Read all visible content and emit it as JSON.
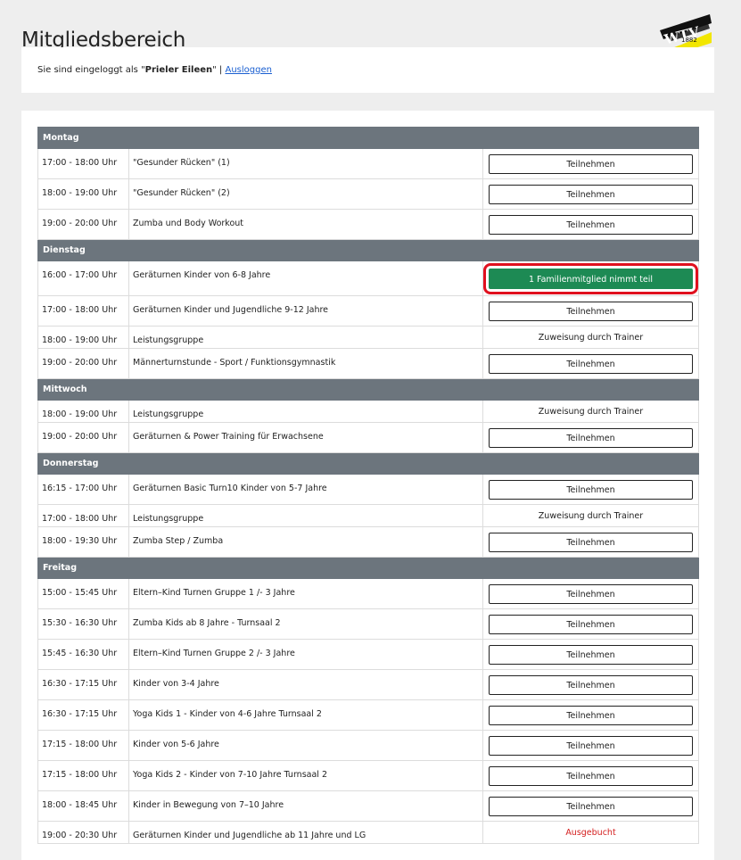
{
  "page": {
    "title": "Mitgliedsbereich",
    "logo_text": "WTV",
    "logo_year": "1882"
  },
  "login": {
    "prefix": "Sie sind eingeloggt als \"",
    "user": "Prieler Eileen",
    "suffix": "\" |",
    "logout_label": "Ausloggen"
  },
  "colors": {
    "day_header_bg": "#6c757d",
    "joined_bg": "#1d8a54",
    "highlight_outline": "#e0101e",
    "booked_text": "#d42020",
    "link": "#1a5fd1"
  },
  "schedule": [
    {
      "day": "Montag",
      "slots": [
        {
          "time": "17:00 - 18:00 Uhr",
          "course": "\"Gesunder Rücken\" (1)",
          "status": "button",
          "label": "Teilnehmen"
        },
        {
          "time": "18:00 - 19:00 Uhr",
          "course": "\"Gesunder Rücken\" (2)",
          "status": "button",
          "label": "Teilnehmen"
        },
        {
          "time": "19:00 - 20:00 Uhr",
          "course": "Zumba und Body Workout",
          "status": "button",
          "label": "Teilnehmen"
        }
      ]
    },
    {
      "day": "Dienstag",
      "slots": [
        {
          "time": "16:00 - 17:00 Uhr",
          "course": "Geräturnen Kinder von 6-8 Jahre",
          "status": "joined",
          "label": "1 Familienmitglied nimmt teil"
        },
        {
          "time": "17:00 - 18:00 Uhr",
          "course": "Geräturnen Kinder und Jugendliche 9-12 Jahre",
          "status": "button",
          "label": "Teilnehmen"
        },
        {
          "time": "18:00 - 19:00 Uhr",
          "course": "Leistungsgruppe",
          "status": "trainer",
          "label": "Zuweisung durch Trainer"
        },
        {
          "time": "19:00 - 20:00 Uhr",
          "course": "Männerturnstunde - Sport / Funktionsgymnastik",
          "status": "button",
          "label": "Teilnehmen"
        }
      ]
    },
    {
      "day": "Mittwoch",
      "slots": [
        {
          "time": "18:00 - 19:00 Uhr",
          "course": "Leistungsgruppe",
          "status": "trainer",
          "label": "Zuweisung durch Trainer"
        },
        {
          "time": "19:00 - 20:00 Uhr",
          "course": "Geräturnen & Power Training für Erwachsene",
          "status": "button",
          "label": "Teilnehmen"
        }
      ]
    },
    {
      "day": "Donnerstag",
      "slots": [
        {
          "time": "16:15 - 17:00 Uhr",
          "course": "Geräturnen Basic Turn10 Kinder von 5-7 Jahre",
          "status": "button",
          "label": "Teilnehmen"
        },
        {
          "time": "17:00 - 18:00 Uhr",
          "course": "Leistungsgruppe",
          "status": "trainer",
          "label": "Zuweisung durch Trainer"
        },
        {
          "time": "18:00 - 19:30 Uhr",
          "course": "Zumba Step / Zumba",
          "status": "button",
          "label": "Teilnehmen"
        }
      ]
    },
    {
      "day": "Freitag",
      "slots": [
        {
          "time": "15:00 - 15:45 Uhr",
          "course": "Eltern–Kind Turnen Gruppe 1 /- 3 Jahre",
          "status": "button",
          "label": "Teilnehmen"
        },
        {
          "time": "15:30 - 16:30 Uhr",
          "course": "Zumba Kids ab 8 Jahre - Turnsaal 2",
          "status": "button",
          "label": "Teilnehmen"
        },
        {
          "time": "15:45 - 16:30 Uhr",
          "course": "Eltern–Kind Turnen Gruppe 2 /- 3 Jahre",
          "status": "button",
          "label": "Teilnehmen"
        },
        {
          "time": "16:30 - 17:15 Uhr",
          "course": "Kinder von 3-4 Jahre",
          "status": "button",
          "label": "Teilnehmen"
        },
        {
          "time": "16:30 - 17:15 Uhr",
          "course": "Yoga Kids 1 - Kinder von 4-6 Jahre Turnsaal 2",
          "status": "button",
          "label": "Teilnehmen"
        },
        {
          "time": "17:15 - 18:00 Uhr",
          "course": "Kinder von 5-6 Jahre",
          "status": "button",
          "label": "Teilnehmen"
        },
        {
          "time": "17:15 - 18:00 Uhr",
          "course": "Yoga Kids 2 - Kinder von 7-10 Jahre Turnsaal 2",
          "status": "button",
          "label": "Teilnehmen"
        },
        {
          "time": "18:00 - 18:45 Uhr",
          "course": "Kinder in Bewegung von 7–10 Jahre",
          "status": "button",
          "label": "Teilnehmen"
        },
        {
          "time": "19:00 - 20:30 Uhr",
          "course": "Geräturnen Kinder und Jugendliche ab 11 Jahre und LG",
          "status": "booked",
          "label": "Ausgebucht"
        }
      ]
    }
  ]
}
